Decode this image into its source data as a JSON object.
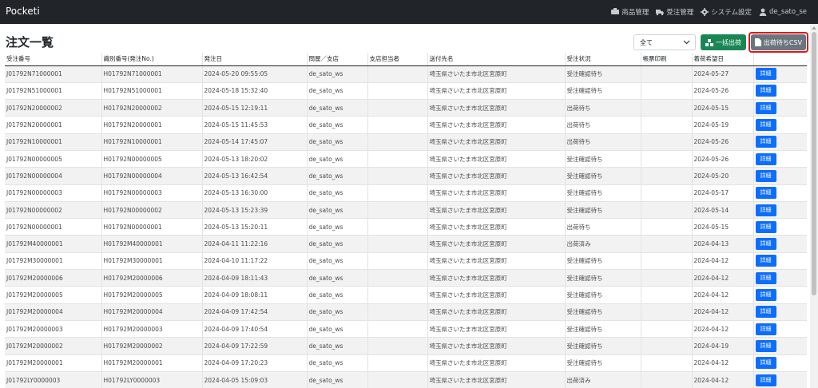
{
  "app": {
    "brand": "Pocketi",
    "nav": [
      {
        "icon": "products-icon",
        "label": "商品管理"
      },
      {
        "icon": "truck-icon",
        "label": "受注管理"
      },
      {
        "icon": "gear-icon",
        "label": "システム設定"
      },
      {
        "icon": "user-icon",
        "label": "de_sato_se"
      }
    ]
  },
  "page": {
    "title": "注文一覧",
    "filter": {
      "selected": "全て"
    },
    "bulk_ship_label": "一括出荷",
    "csv_label": "出荷待ちCSV"
  },
  "table": {
    "columns": [
      "受注番号",
      "識別番号(発注No.)",
      "発注日",
      "問屋／支店",
      "支店担当者",
      "送付先名",
      "受注状況",
      "帳票印刷",
      "着荷希望日",
      ""
    ],
    "detail_label": "詳細",
    "rows": [
      {
        "order_no": "J01792N71000001",
        "id_no": "H01792N71000001",
        "date": "2024-05-20 09:55:05",
        "wholesaler": "de_sato_ws",
        "staff": "",
        "dest": "埼玉県さいたま市北区宮原町",
        "status": "受注確認待ち",
        "print": "",
        "due": "2024-05-27"
      },
      {
        "order_no": "J01792N51000001",
        "id_no": "H01792N51000001",
        "date": "2024-05-18 15:32:40",
        "wholesaler": "de_sato_ws",
        "staff": "",
        "dest": "埼玉県さいたま市北区宮原町",
        "status": "受注確認待ち",
        "print": "",
        "due": "2024-05-26"
      },
      {
        "order_no": "J01792N20000002",
        "id_no": "H01792N20000002",
        "date": "2024-05-15 12:19:11",
        "wholesaler": "de_sato_ws",
        "staff": "",
        "dest": "埼玉県さいたま市北区宮原町",
        "status": "出荷待ち",
        "print": "",
        "due": "2024-05-15"
      },
      {
        "order_no": "J01792N20000001",
        "id_no": "H01792N20000001",
        "date": "2024-05-15 11:45:53",
        "wholesaler": "de_sato_ws",
        "staff": "",
        "dest": "埼玉県さいたま市北区宮原町",
        "status": "出荷待ち",
        "print": "",
        "due": "2024-05-19"
      },
      {
        "order_no": "J01792N10000001",
        "id_no": "H01792N10000001",
        "date": "2024-05-14 17:45:07",
        "wholesaler": "de_sato_ws",
        "staff": "",
        "dest": "埼玉県さいたま市北区宮原町",
        "status": "出荷待ち",
        "print": "",
        "due": "2024-05-26"
      },
      {
        "order_no": "J01792N00000005",
        "id_no": "H01792N00000005",
        "date": "2024-05-13 18:20:02",
        "wholesaler": "de_sato_ws",
        "staff": "",
        "dest": "埼玉県さいたま市北区宮原町",
        "status": "受注確認待ち",
        "print": "",
        "due": "2024-05-26"
      },
      {
        "order_no": "J01792N00000004",
        "id_no": "H01792N00000004",
        "date": "2024-05-13 16:42:54",
        "wholesaler": "de_sato_ws",
        "staff": "",
        "dest": "埼玉県さいたま市北区宮原町",
        "status": "受注確認待ち",
        "print": "",
        "due": "2024-05-20"
      },
      {
        "order_no": "J01792N00000003",
        "id_no": "H01792N00000003",
        "date": "2024-05-13 16:30:00",
        "wholesaler": "de_sato_ws",
        "staff": "",
        "dest": "埼玉県さいたま市北区宮原町",
        "status": "受注確認待ち",
        "print": "",
        "due": "2024-05-17"
      },
      {
        "order_no": "J01792N00000002",
        "id_no": "H01792N00000002",
        "date": "2024-05-13 15:23:39",
        "wholesaler": "de_sato_ws",
        "staff": "",
        "dest": "埼玉県さいたま市北区宮原町",
        "status": "受注確認待ち",
        "print": "",
        "due": "2024-05-14"
      },
      {
        "order_no": "J01792N00000001",
        "id_no": "H01792N00000001",
        "date": "2024-05-13 15:20:11",
        "wholesaler": "de_sato_ws",
        "staff": "",
        "dest": "埼玉県さいたま市北区宮原町",
        "status": "出荷待ち",
        "print": "",
        "due": "2024-05-15"
      },
      {
        "order_no": "J01792M40000001",
        "id_no": "H01792M40000001",
        "date": "2024-04-11 11:22:16",
        "wholesaler": "de_sato_ws",
        "staff": "",
        "dest": "埼玉県さいたま市北区宮原町",
        "status": "出荷済み",
        "print": "",
        "due": "2024-04-13"
      },
      {
        "order_no": "J01792M30000001",
        "id_no": "H01792M30000001",
        "date": "2024-04-10 11:17:22",
        "wholesaler": "de_sato_ws",
        "staff": "",
        "dest": "埼玉県さいたま市北区宮原町",
        "status": "受注確認待ち",
        "print": "",
        "due": "2024-04-12"
      },
      {
        "order_no": "J01792M20000006",
        "id_no": "H01792M20000006",
        "date": "2024-04-09 18:11:43",
        "wholesaler": "de_sato_ws",
        "staff": "",
        "dest": "埼玉県さいたま市北区宮原町",
        "status": "受注確認待ち",
        "print": "",
        "due": "2024-04-12"
      },
      {
        "order_no": "J01792M20000005",
        "id_no": "H01792M20000005",
        "date": "2024-04-09 18:08:11",
        "wholesaler": "de_sato_ws",
        "staff": "",
        "dest": "埼玉県さいたま市北区宮原町",
        "status": "受注確認待ち",
        "print": "",
        "due": "2024-04-12"
      },
      {
        "order_no": "J01792M20000004",
        "id_no": "H01792M20000004",
        "date": "2024-04-09 17:42:54",
        "wholesaler": "de_sato_ws",
        "staff": "",
        "dest": "埼玉県さいたま市北区宮原町",
        "status": "受注確認待ち",
        "print": "",
        "due": "2024-04-12"
      },
      {
        "order_no": "J01792M20000003",
        "id_no": "H01792M20000003",
        "date": "2024-04-09 17:40:54",
        "wholesaler": "de_sato_ws",
        "staff": "",
        "dest": "埼玉県さいたま市北区宮原町",
        "status": "受注確認待ち",
        "print": "",
        "due": "2024-04-12"
      },
      {
        "order_no": "J01792M20000002",
        "id_no": "H01792M20000002",
        "date": "2024-04-09 17:22:59",
        "wholesaler": "de_sato_ws",
        "staff": "",
        "dest": "埼玉県さいたま市北区宮原町",
        "status": "受注確認待ち",
        "print": "",
        "due": "2024-04-19"
      },
      {
        "order_no": "J01792M20000001",
        "id_no": "H01792M20000001",
        "date": "2024-04-09 17:20:23",
        "wholesaler": "de_sato_ws",
        "staff": "",
        "dest": "埼玉県さいたま市北区宮原町",
        "status": "受注確認待ち",
        "print": "",
        "due": "2024-04-12"
      },
      {
        "order_no": "J01792LY0000003",
        "id_no": "H01792LY0000003",
        "date": "2024-04-05 15:09:03",
        "wholesaler": "de_sato_ws",
        "staff": "",
        "dest": "埼玉県さいたま市北区宮原町",
        "status": "出荷済み",
        "print": "",
        "due": "2024-04-12"
      }
    ]
  }
}
